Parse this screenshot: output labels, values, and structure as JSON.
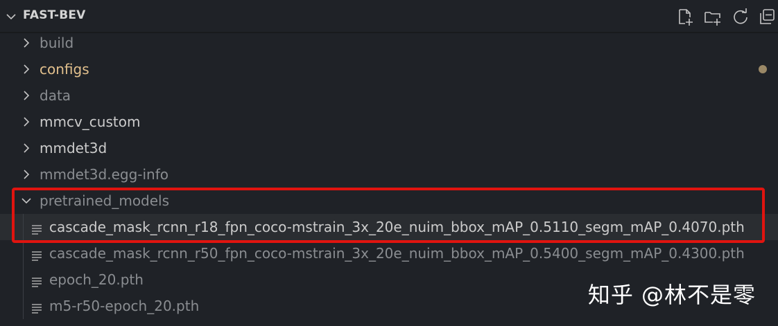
{
  "explorer": {
    "root_title": "FAST-BEV",
    "toolbar": {
      "new_file": "new-file-icon",
      "new_folder": "new-folder-icon",
      "refresh": "refresh-icon",
      "collapse_all": "collapse-all-icon"
    },
    "items": [
      {
        "kind": "folder",
        "label": "build",
        "expanded": false,
        "state": "ignored"
      },
      {
        "kind": "folder",
        "label": "configs",
        "expanded": false,
        "state": "modified"
      },
      {
        "kind": "folder",
        "label": "data",
        "expanded": false,
        "state": "ignored"
      },
      {
        "kind": "folder",
        "label": "mmcv_custom",
        "expanded": false,
        "state": "normal"
      },
      {
        "kind": "folder",
        "label": "mmdet3d",
        "expanded": false,
        "state": "normal"
      },
      {
        "kind": "folder",
        "label": "mmdet3d.egg-info",
        "expanded": false,
        "state": "ignored"
      },
      {
        "kind": "folder",
        "label": "pretrained_models",
        "expanded": true,
        "state": "ignored"
      },
      {
        "kind": "file",
        "label": "cascade_mask_rcnn_r18_fpn_coco-mstrain_3x_20e_nuim_bbox_mAP_0.5110_segm_mAP_0.4070.pth",
        "state": "selected"
      },
      {
        "kind": "file",
        "label": "cascade_mask_rcnn_r50_fpn_coco-mstrain_3x_20e_nuim_bbox_mAP_0.5400_segm_mAP_0.4300.pth",
        "state": "ignored"
      },
      {
        "kind": "file",
        "label": "epoch_20.pth",
        "state": "ignored"
      },
      {
        "kind": "file",
        "label": "m5-r50-epoch_20.pth",
        "state": "ignored"
      }
    ]
  },
  "watermark": "知乎 @林不是零",
  "colors": {
    "background": "#1f2227",
    "text": "#cccccc",
    "modified": "#e2c08d",
    "ignored": "#8a8d91",
    "highlight_box": "#e0140f"
  }
}
